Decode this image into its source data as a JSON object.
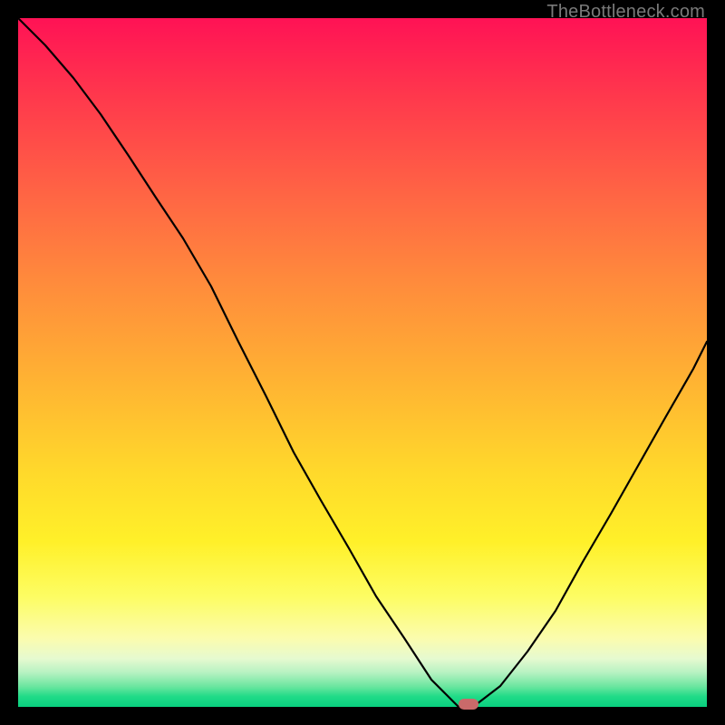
{
  "watermark": "TheBottleneck.com",
  "colors": {
    "background": "#000000",
    "curve": "#000000",
    "marker": "#c96a6a",
    "gradient_top": "#ff1255",
    "gradient_bottom": "#09d07f"
  },
  "chart_data": {
    "type": "line",
    "title": "",
    "xlabel": "",
    "ylabel": "",
    "xlim": [
      0,
      100
    ],
    "ylim": [
      0,
      100
    ],
    "series": [
      {
        "name": "bottleneck-curve",
        "x": [
          0,
          4,
          8,
          12,
          16,
          20,
          24,
          28,
          32,
          36,
          40,
          44,
          48,
          52,
          56,
          60,
          62,
          64,
          66,
          70,
          74,
          78,
          82,
          86,
          90,
          94,
          98,
          100
        ],
        "values": [
          100,
          96,
          91,
          86,
          80,
          74,
          68,
          61,
          53,
          45,
          37,
          30,
          23,
          16,
          10,
          4,
          2,
          0,
          0,
          3,
          8,
          14,
          21,
          28,
          35,
          42,
          49,
          53
        ]
      }
    ],
    "marker": {
      "x": 65,
      "y": 0
    },
    "annotations": []
  }
}
